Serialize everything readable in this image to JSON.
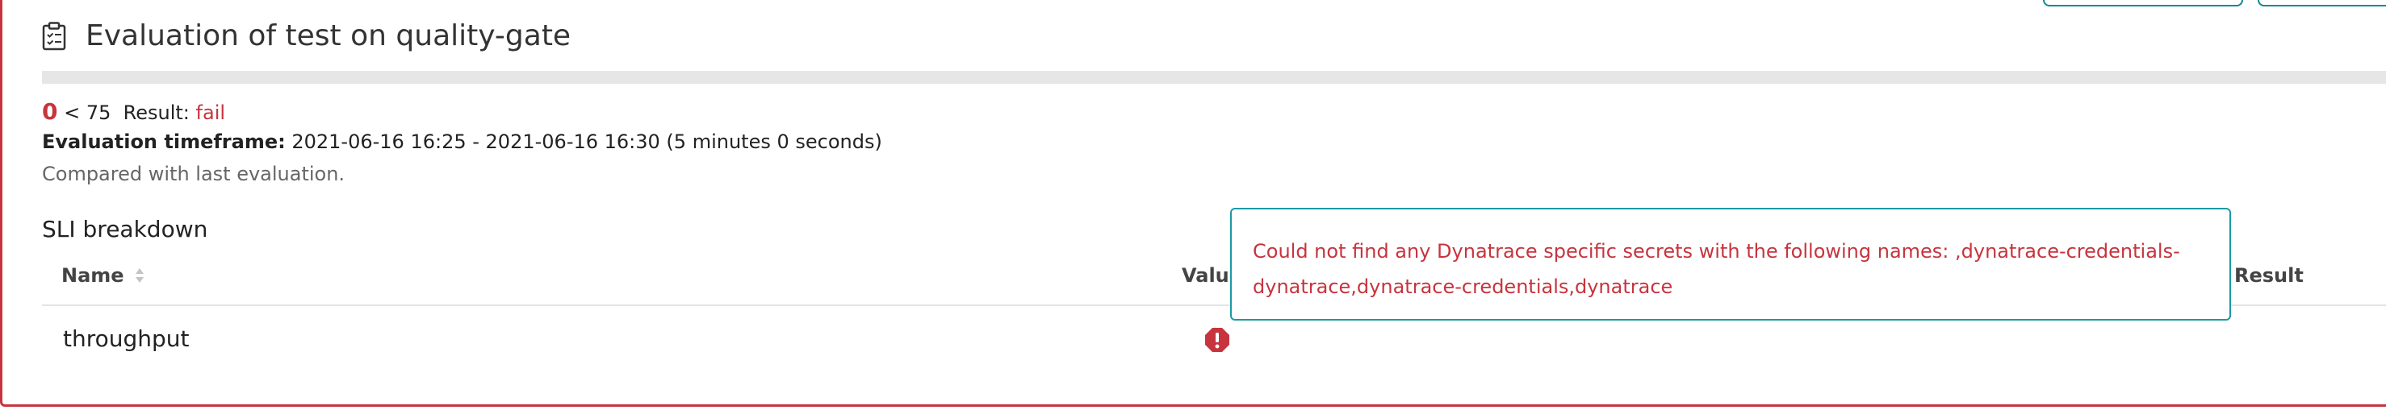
{
  "evaluation": {
    "title": "Evaluation of test on quality-gate",
    "score": "0",
    "threshold_text": " < 75  Result: ",
    "result": "fail",
    "timeframe_label": "Evaluation timeframe:",
    "timeframe_value": " 2021-06-16 16:25 - 2021-06-16 16:30 (5 minutes 0 seconds)",
    "compared_text": "Compared with last evaluation."
  },
  "sli": {
    "heading": "SLI breakdown",
    "columns": {
      "name": "Name",
      "value": "Value",
      "result": "Result"
    },
    "rows": [
      {
        "name": "throughput"
      }
    ]
  },
  "tooltip": {
    "line1": "Could not find any Dynatrace specific secrets with the following names: ,dynatrace-credentials-",
    "line2": "dynatrace,dynatrace-credentials,dynatrace"
  },
  "colors": {
    "accent_error": "#c7343e",
    "accent_teal": "#1a9aa3"
  },
  "icons": {
    "title_icon": "clipboard-icon",
    "sort_icon": "sort-icon",
    "row_status_icon": "error-icon"
  }
}
